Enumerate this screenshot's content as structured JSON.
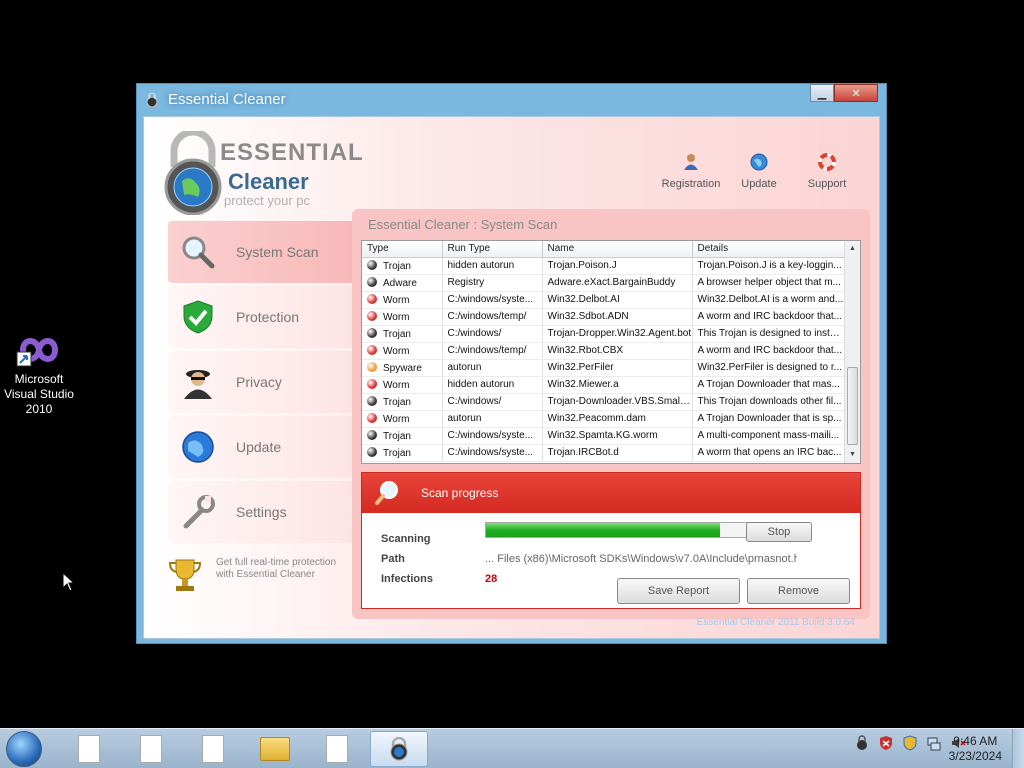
{
  "desktop": {
    "icon_label_line1": "Microsoft",
    "icon_label_line2": "Visual Studio",
    "icon_label_line3": "2010"
  },
  "window": {
    "title": "Essential Cleaner",
    "minimize_glyph": "▁",
    "close_glyph": "✕"
  },
  "logo": {
    "line1": "ESSENTIAL",
    "line2": "Cleaner",
    "tagline": "protect your pc"
  },
  "toplinks": [
    {
      "label": "Registration",
      "icon": "user-icon"
    },
    {
      "label": "Update",
      "icon": "globe-icon"
    },
    {
      "label": "Support",
      "icon": "lifebuoy-icon"
    }
  ],
  "nav": [
    {
      "label": "System Scan",
      "icon": "magnifier-icon",
      "active": true
    },
    {
      "label": "Protection",
      "icon": "shield-check-icon",
      "active": false
    },
    {
      "label": "Privacy",
      "icon": "spy-icon",
      "active": false
    },
    {
      "label": "Update",
      "icon": "globe-icon",
      "active": false
    },
    {
      "label": "Settings",
      "icon": "wrench-icon",
      "active": false
    }
  ],
  "promo": {
    "text": "Get full real-time protection with Essential Cleaner"
  },
  "panel": {
    "title": "Essential Cleaner : System Scan"
  },
  "table": {
    "columns": [
      "Type",
      "Run Type",
      "Name",
      "Details"
    ],
    "rows": [
      {
        "type": "Trojan",
        "run": "hidden autorun",
        "name": "Trojan.Poison.J",
        "details": "Trojan.Poison.J is a key-loggin...",
        "dot": "#333333"
      },
      {
        "type": "Adware",
        "run": "Registry",
        "name": "Adware.eXact.BargainBuddy",
        "details": "A browser helper object that m...",
        "dot": "#333333"
      },
      {
        "type": "Worm",
        "run": "C:/windows/syste...",
        "name": "Win32.Delbot.AI",
        "details": "Win32.Delbot.AI is a worm and...",
        "dot": "#d83030"
      },
      {
        "type": "Worm",
        "run": "C:/windows/temp/",
        "name": "Win32.Sdbot.ADN",
        "details": "A worm and IRC backdoor that...",
        "dot": "#d83030"
      },
      {
        "type": "Trojan",
        "run": "C:/windows/",
        "name": "Trojan-Dropper.Win32.Agent.bot",
        "details": "This Trojan is designed to insta...",
        "dot": "#333333"
      },
      {
        "type": "Worm",
        "run": "C:/windows/temp/",
        "name": "Win32.Rbot.CBX",
        "details": "A worm and IRC backdoor that...",
        "dot": "#d83030"
      },
      {
        "type": "Spyware",
        "run": "autorun",
        "name": "Win32.PerFiler",
        "details": "Win32.PerFiler is designed to r...",
        "dot": "#f09a30"
      },
      {
        "type": "Worm",
        "run": "hidden autorun",
        "name": "Win32.Miewer.a",
        "details": "A Trojan Downloader that mas...",
        "dot": "#d83030"
      },
      {
        "type": "Trojan",
        "run": "C:/windows/",
        "name": "Trojan-Downloader.VBS.Small.dc",
        "details": "This Trojan downloads other fil...",
        "dot": "#333333"
      },
      {
        "type": "Worm",
        "run": "autorun",
        "name": "Win32.Peacomm.dam",
        "details": "A Trojan Downloader that is sp...",
        "dot": "#d83030"
      },
      {
        "type": "Trojan",
        "run": "C:/windows/syste...",
        "name": "Win32.Spamta.KG.worm",
        "details": "A multi-component mass-maili...",
        "dot": "#333333"
      },
      {
        "type": "Trojan",
        "run": "C:/windows/syste...",
        "name": "Trojan.IRCBot.d",
        "details": "A worm that opens an IRC bac...",
        "dot": "#333333"
      }
    ]
  },
  "scan": {
    "title": "Scan progress",
    "scanning_label": "Scanning",
    "path_label": "Path",
    "infections_label": "Infections",
    "path_value": "... Files (x86)\\Microsoft SDKs\\Windows\\v7.0A\\Include\\prnasnot.h",
    "infections_value": "28",
    "progress_fraction": 0.76,
    "stop_label": "Stop",
    "save_label": "Save Report",
    "remove_label": "Remove"
  },
  "build": "Essential Cleaner 2011 Build 3.0.64",
  "taskbar": {
    "time": "9:46 AM",
    "date": "3/23/2024"
  }
}
